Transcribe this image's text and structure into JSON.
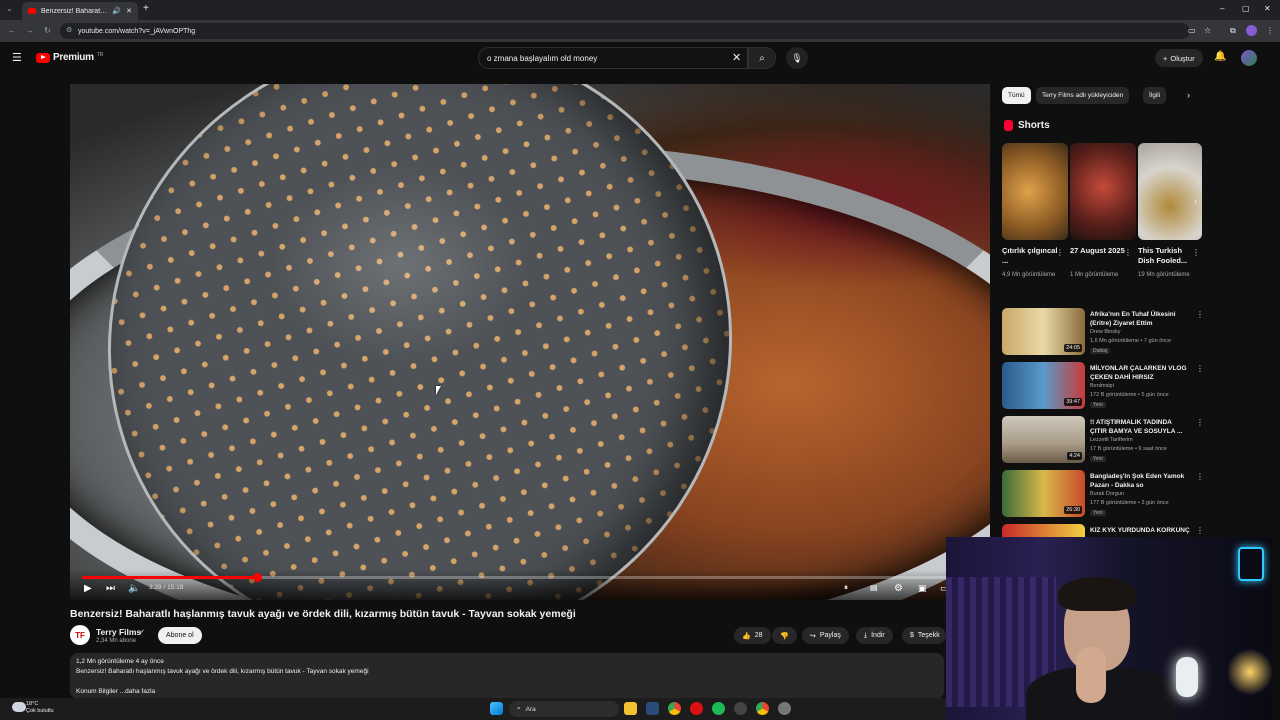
{
  "browser": {
    "tab_title": "Benzersiz! Baharatlı haşlanmış",
    "url": "youtube.com/watch?v=_jAVwnOPThg"
  },
  "header": {
    "logo_text": "Premium",
    "logo_region": "TR",
    "search_value": "o zmana başlayalım old money",
    "create_label": "Oluştur"
  },
  "player": {
    "time": "3:39 / 15:18",
    "progress": 0.195
  },
  "video": {
    "title": "Benzersiz! Baharatlı haşlanmış tavuk ayağı ve ördek dili, kızarmış bütün tavuk - Tayvan sokak yemeği",
    "channel": "Terry Films",
    "channel_initials": "TF",
    "subscribers": "2,34 Mn abone",
    "subscribe_label": "Abone ol",
    "likes": "28",
    "share_label": "Paylaş",
    "download_label": "İndir",
    "thanks_label": "Teşekk",
    "views_age": "1,2 Mn görüntüleme  4 ay önce",
    "description": "Benzersiz! Baharatlı haşlanmış tavuk ayağı ve ördek dili, kızarmış bütün tavuk - Tayvan sokak yemeği",
    "location_more": "Konum Bilgiler ...daha fazla"
  },
  "sidebar": {
    "chips": [
      "Tümü",
      "Terry Films adlı yükleyiciden",
      "İlgili"
    ],
    "shorts_label": "Shorts",
    "shorts": [
      {
        "title": "Çıtırlık çılgıncal ...",
        "views": "4,9 Mn görüntüleme"
      },
      {
        "title": "27 August 2025",
        "views": "1 Mn görüntüleme"
      },
      {
        "title": "This Turkish Dish Fooled...",
        "views": "19 Mn görüntüleme"
      }
    ],
    "recs": [
      {
        "title": "Afrika'nın En Tuhaf Ülkesini (Eritre) Ziyaret Ettim",
        "channel": "Drew Binsky",
        "meta": "1,6 Mn görüntüleme • 7 gün önce",
        "badge": "Dublaj",
        "duration": "24:05"
      },
      {
        "title": "MİLYONLAR ÇALARKEN VLOG ÇEKEN DAHİ HIRSIZ",
        "channel": "Benimsipi",
        "meta": "172 B görüntüleme • 5 gün önce",
        "badge": "Yeni",
        "duration": "39:47"
      },
      {
        "title": "!! ATIŞTIRMALIK TADINDA ÇITIR BAMYA VE SOSUYLA ...",
        "channel": "Lezzetli Tarifterim",
        "meta": "17 B görüntüleme • 9 saat önce",
        "badge": "Yeni",
        "duration": "4:24"
      },
      {
        "title": "Bangladeş'in Şok Eden Yamok Pazarı - Dakka so",
        "channel": "Burak Dorgun",
        "meta": "177 B görüntüleme • 3 gün önce",
        "badge": "Yeni",
        "duration": "26:30"
      },
      {
        "title": "KIZ KYK YURDUNDA KORKUNÇ",
        "channel": "",
        "meta": "",
        "badge": "",
        "duration": ""
      }
    ]
  },
  "taskbar": {
    "weather_temp": "18°C",
    "weather_desc": "Çok bulutlu",
    "search_label": "Ara"
  }
}
